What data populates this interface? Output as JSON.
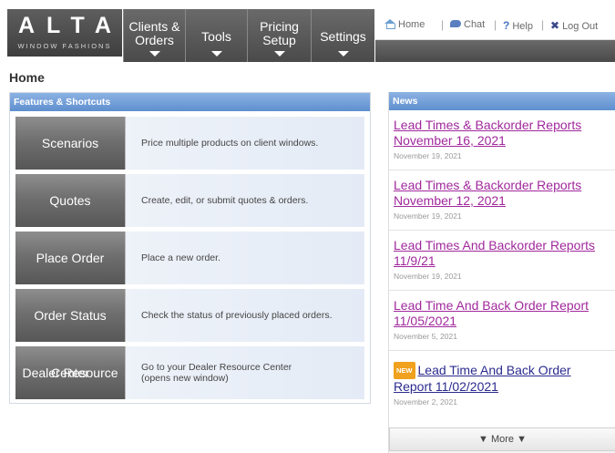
{
  "logo": {
    "main": "ALTA",
    "sub": "WINDOW FASHIONS"
  },
  "nav": [
    {
      "label": "Clients & Orders",
      "line1": "Clients &",
      "line2": "Orders"
    },
    {
      "label": "Tools"
    },
    {
      "label": "Pricing Setup",
      "line1": "Pricing",
      "line2": "Setup"
    },
    {
      "label": "Settings"
    }
  ],
  "util": {
    "home": "Home",
    "chat": "Chat",
    "help": "Help",
    "logout": "Log Out",
    "separator": "|"
  },
  "page_title": "Home",
  "features": {
    "title": "Features & Shortcuts",
    "rows": [
      {
        "button": "Scenarios",
        "desc": "Price multiple products on client windows."
      },
      {
        "button": "Quotes",
        "desc": "Create, edit, or submit quotes & orders."
      },
      {
        "button": "Place Order",
        "desc": "Place a new order."
      },
      {
        "button": "Order Status",
        "desc": "Check the status of previously placed orders."
      },
      {
        "button": "Dealer Resource Center",
        "button_l1": "Dealer Resource",
        "button_l2": "Center",
        "desc": "Go to your Dealer Resource Center (opens new window)",
        "desc_l1": "Go to your Dealer Resource Center",
        "desc_l2": "(opens new window)"
      }
    ]
  },
  "news": {
    "title": "News",
    "items": [
      {
        "title": "Lead Times & Backorder Reports November 16, 2021",
        "date": "November 19, 2021"
      },
      {
        "title": "Lead Times & Backorder Reports November 12, 2021",
        "date": "November 19, 2021"
      },
      {
        "title": "Lead Times And Backorder Reports 11/9/21",
        "date": "November 19, 2021"
      },
      {
        "title": "Lead Time And Back Order Report 11/05/2021",
        "date": "November 5, 2021"
      },
      {
        "title": "Lead Time And Back Order Report 11/02/2021",
        "date": "November 2, 2021",
        "badge": "NEW"
      }
    ],
    "more": "▼  More  ▼"
  },
  "colors": {
    "panel_header": "#5f8fcf",
    "nav_bg": "#4a4a4a",
    "link_unvisited": "#a0289c",
    "link_visited": "#2b2b8f",
    "badge": "#f0a11e"
  }
}
